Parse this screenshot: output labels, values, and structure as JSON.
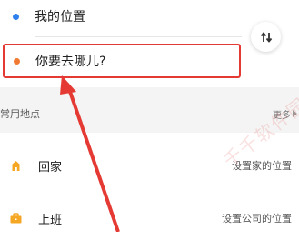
{
  "route": {
    "from_label": "我的位置",
    "to_placeholder": "你要去哪儿?"
  },
  "common_places": {
    "title": "常用地点",
    "more_label": "更多",
    "items": [
      {
        "label": "回家",
        "action": "设置家的位置",
        "icon": "home-icon"
      },
      {
        "label": "上班",
        "action": "设置公司的位置",
        "icon": "briefcase-icon"
      }
    ]
  },
  "watermark_text": "千千软件园",
  "colors": {
    "from_dot": "#2f80ed",
    "to_dot": "#f07a32",
    "icon_orange": "#f5a623",
    "annotation_red": "#e53a33"
  }
}
